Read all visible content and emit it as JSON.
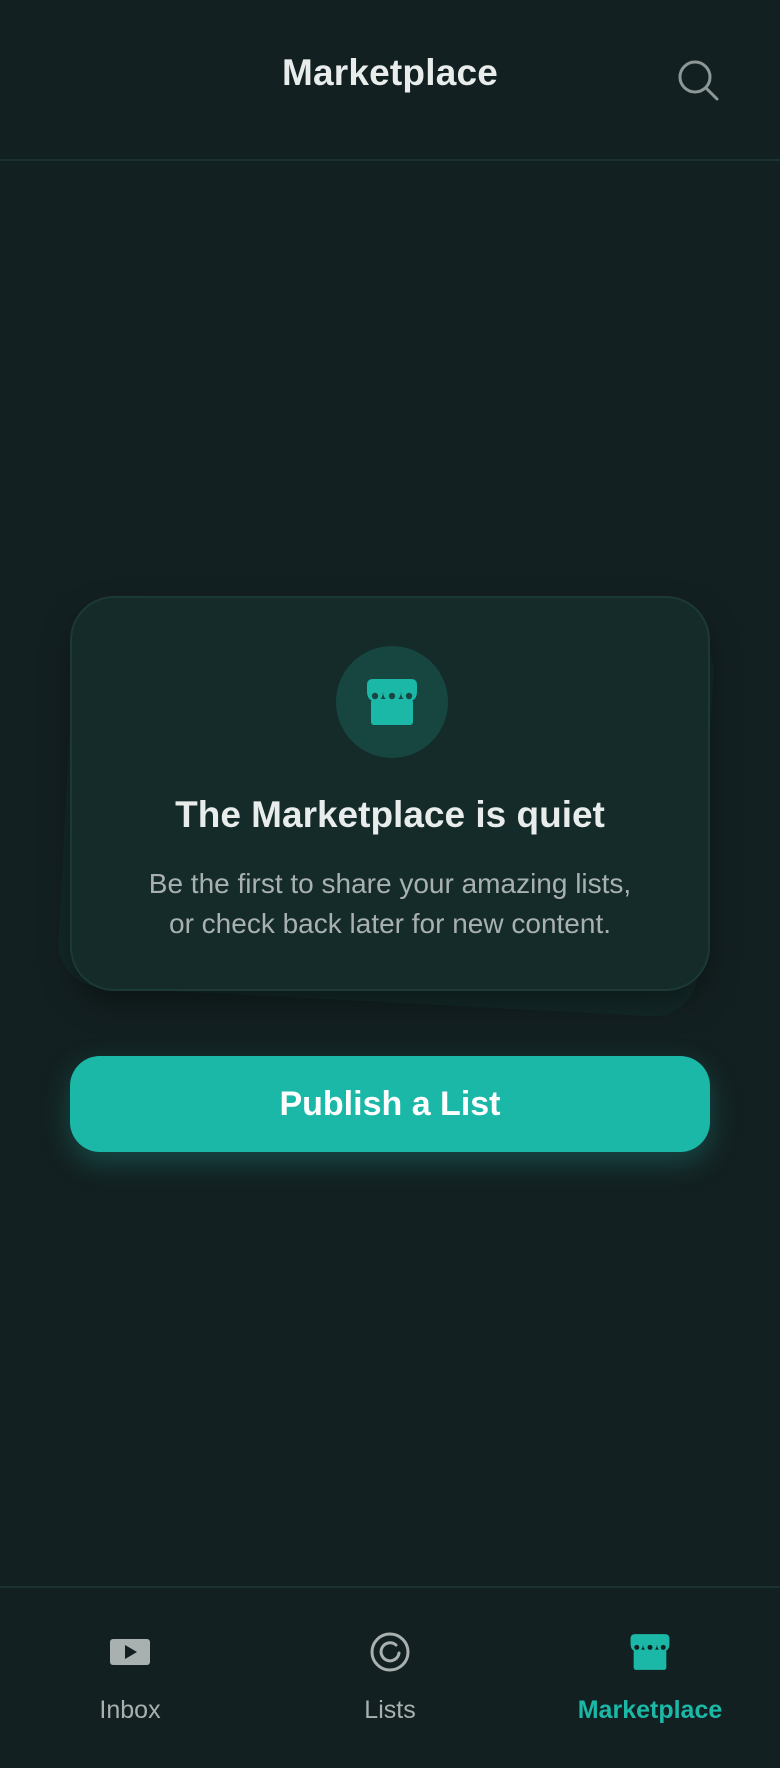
{
  "header": {
    "title": "Marketplace",
    "search_icon": "search-icon"
  },
  "empty_state": {
    "icon": "storefront-icon",
    "title": "The Marketplace is quiet",
    "description_line1": "Be the first to share your amazing lists,",
    "description_line2": "or check back later for new content."
  },
  "actions": {
    "publish_label": "Publish a List"
  },
  "bottom_nav": {
    "items": [
      {
        "label": "Inbox",
        "icon": "video-icon",
        "active": false
      },
      {
        "label": "Lists",
        "icon": "refresh-circle-icon",
        "active": false
      },
      {
        "label": "Marketplace",
        "icon": "storefront-icon",
        "active": true
      }
    ]
  },
  "colors": {
    "background": "#132021",
    "accent": "#1bb8a8",
    "card": "#142b29",
    "text_primary": "#e8eceb",
    "text_secondary": "#a8b1af"
  }
}
